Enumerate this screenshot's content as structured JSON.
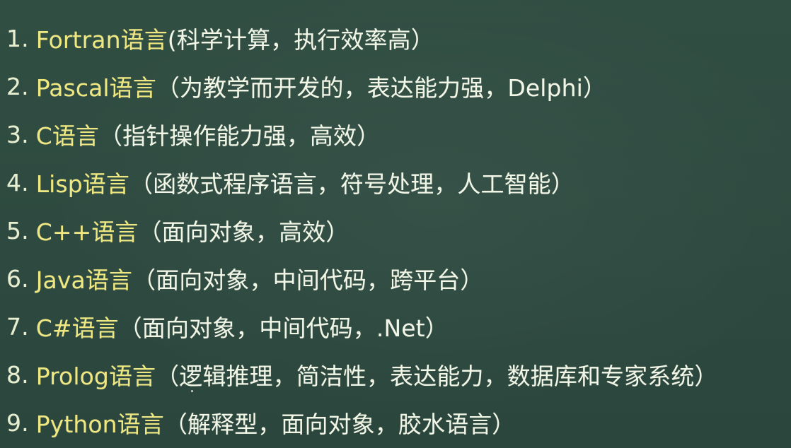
{
  "items": [
    {
      "num": "1.",
      "lang": "Fortran语言",
      "desc": "(科学计算，执行效率高）"
    },
    {
      "num": "2.",
      "lang": "Pascal语言",
      "desc": "（为教学而开发的，表达能力强，Delphi）"
    },
    {
      "num": "3.",
      "lang": "C语言",
      "desc": "（指针操作能力强，高效）"
    },
    {
      "num": "4.",
      "lang": "Lisp语言",
      "desc": "（函数式程序语言，符号处理，人工智能）"
    },
    {
      "num": "5.",
      "lang": "C++语言",
      "desc": "（面向对象，高效）"
    },
    {
      "num": "6.",
      "lang": "Java语言",
      "desc": "（面向对象，中间代码，跨平台）"
    },
    {
      "num": "7.",
      "lang": "C#语言",
      "desc": "（面向对象，中间代码，.Net）"
    },
    {
      "num": "8.",
      "lang": "Prolog语言",
      "desc": "（逻辑推理，简洁性，表达能力，数据库和专家系统）"
    },
    {
      "num": "9.",
      "lang": "Python语言",
      "desc": "（解释型，面向对象，胶水语言）"
    }
  ],
  "colors": {
    "board": "#2f4b41",
    "language_name": "#efe77f",
    "description": "#f2f6e6",
    "number": "#e8efd0"
  }
}
